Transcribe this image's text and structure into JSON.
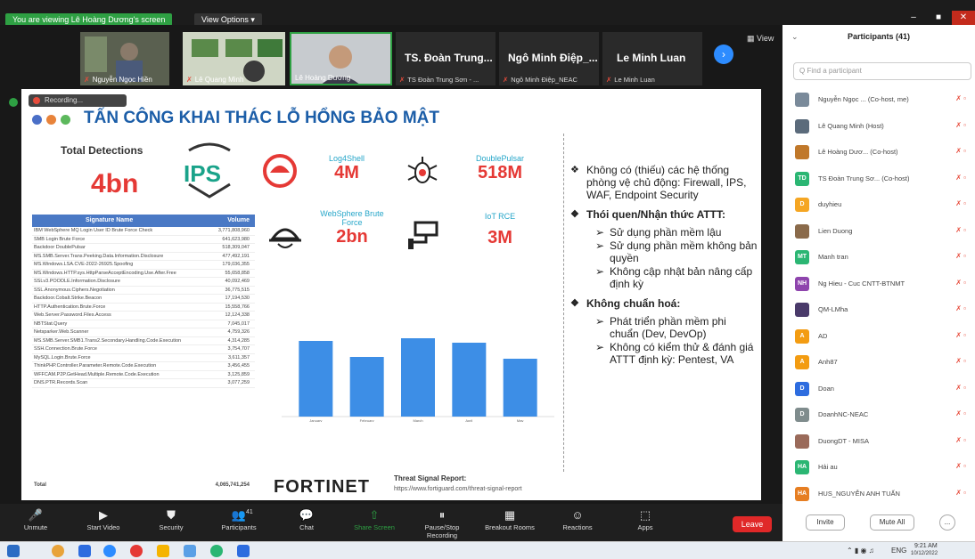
{
  "top": {
    "share_banner": "You are viewing Lê Hoàng Dương's screen",
    "view_options": "View Options ▾",
    "minimize": "–",
    "restore": "■",
    "close": "✕"
  },
  "gallery": {
    "thumbs": [
      {
        "name": "Nguyễn Ngọc Hiền"
      },
      {
        "name": "Lê Quang Minh"
      },
      {
        "name": "Lê Hoàng Dương"
      }
    ],
    "tiles": [
      {
        "title": "TS. Đoàn Trung...",
        "sub": "TS Đoàn Trung Sơn - ..."
      },
      {
        "title": "Ngô Minh Điệp_...",
        "sub": "Ngô Minh Điệp_NEAC"
      },
      {
        "title": "Le Minh Luan",
        "sub": "Le Minh Luan"
      }
    ],
    "next_icon": "chevron-right-icon",
    "view_label": "View"
  },
  "slide": {
    "recording": "Recording...",
    "title": "TẤN CÔNG KHAI THÁC LỖ HỔNG BẢO MẬT",
    "total_label": "Total Detections",
    "total_value": "4bn",
    "ips_label": "IPS",
    "threats": [
      {
        "name": "Log4Shell",
        "value": "4M",
        "icon": "helmet-icon"
      },
      {
        "name": "DoublePulsar",
        "value": "518M",
        "icon": "bug-icon"
      },
      {
        "name": "WebSphere Brute Force",
        "value": "2bn",
        "icon": "hacker-icon"
      },
      {
        "name": "IoT RCE",
        "value": "3M",
        "icon": "camera-icon"
      }
    ],
    "table": {
      "headers": [
        "Signature Name",
        "Volume"
      ],
      "rows": [
        [
          "IBM WebSphere MQ Login User ID Brute Force Check",
          "3,771,808,960"
        ],
        [
          "SMB Login Brute Force",
          "641,623,980"
        ],
        [
          "Backdoor DoublePulsar",
          "518,309,047"
        ],
        [
          "MS.SMB.Server.Trans.Peeking.Data.Information.Disclosure",
          "477,492,191"
        ],
        [
          "MS.Windows.LSA.CVE-2022-26925.Spoofing",
          "179,036,355"
        ],
        [
          "MS.Windows.HTTP.sys.HttpParseAcceptEncoding.Use.After.Free",
          "55,658,858"
        ],
        [
          "SSLv3.POODLE.Information.Disclosure",
          "40,092,469"
        ],
        [
          "SSL.Anonymous.Ciphers.Negotiation",
          "36,775,515"
        ],
        [
          "Backdoor.Cobalt.Strike.Beacon",
          "17,194,530"
        ],
        [
          "HTTP.Authentication.Brute.Force",
          "15,558,766"
        ],
        [
          "Web.Server.Password.Files.Access",
          "12,124,338"
        ],
        [
          "NBTStat.Query",
          "7,045,017"
        ],
        [
          "Netsparker.Web.Scanner",
          "4,759,326"
        ],
        [
          "MS.SMB.Server.SMB1.Trans2.Secondary.Handling.Code.Execution",
          "4,314,285"
        ],
        [
          "SSH.Connection.Brute.Force",
          "3,754,707"
        ],
        [
          "MySQL.Login.Brute.Force",
          "3,611,357"
        ],
        [
          "ThinkPHP.Controller.Parameter.Remote.Code.Execution",
          "3,456,455"
        ],
        [
          "WFFCAM.P2P.GetHead.Multiple.Remote.Code.Execution",
          "3,125,859"
        ],
        [
          "DNS.PTR.Records.Scan",
          "3,077,259"
        ]
      ],
      "total_label": "Total",
      "total_value": "4,065,741,254"
    },
    "fortinet": "FORTINET",
    "report_title": "Threat Signal Report:",
    "report_url": "https://www.fortiguard.com/threat-signal-report",
    "bullets": [
      {
        "main": "Không có (thiếu) các hệ thống phòng vệ chủ động: Firewall, IPS, WAF, Endpoint Security",
        "subs": []
      },
      {
        "main": "Thói quen/Nhận thức ATTT:",
        "subs": [
          "Sử dụng phần mềm lậu",
          "Sử dụng phần mềm không bản quyền",
          "Không cập nhật bản nâng cấp định kỳ"
        ]
      },
      {
        "main": "Không chuẩn hoá:",
        "subs": [
          "Phát triển phần mềm phi chuẩn (Dev, DevOp)",
          "Không có kiểm thử & đánh giá ATTT định kỳ: Pentest, VA"
        ]
      }
    ]
  },
  "chart_data": {
    "type": "bar",
    "categories": [
      "January",
      "February",
      "March",
      "April",
      "May"
    ],
    "values": [
      0.85,
      0.67,
      0.88,
      0.83,
      0.65
    ],
    "title": "",
    "xlabel": "",
    "ylabel": "",
    "color": "#3d8ee6"
  },
  "toolbar": {
    "items": [
      {
        "label": "Unmute",
        "icon": "mic-off-icon"
      },
      {
        "label": "Start Video",
        "icon": "video-off-icon"
      },
      {
        "label": "Security",
        "icon": "shield-icon"
      },
      {
        "label": "Participants",
        "icon": "participants-icon",
        "count": "41"
      },
      {
        "label": "Chat",
        "icon": "chat-icon"
      },
      {
        "label": "Share Screen",
        "icon": "share-screen-icon"
      },
      {
        "label": "Pause/Stop Recording",
        "icon": "record-icon"
      },
      {
        "label": "Breakout Rooms",
        "icon": "breakout-icon"
      },
      {
        "label": "Reactions",
        "icon": "reaction-icon"
      },
      {
        "label": "Apps",
        "icon": "apps-icon"
      }
    ],
    "leave": "Leave"
  },
  "panel": {
    "title": "Participants (41)",
    "search_placeholder": "Q Find a participant",
    "participants": [
      {
        "name": "Nguyễn Ngọc ... (Co-host, me)",
        "initials": "",
        "color": "#7a8a9a"
      },
      {
        "name": "Lê Quang Minh (Host)",
        "initials": "",
        "color": "#5b6b7b"
      },
      {
        "name": "Lê Hoàng Dươ... (Co-host)",
        "initials": "",
        "color": "#c0782a"
      },
      {
        "name": "TS Đoàn Trung Sơ... (Co-host)",
        "initials": "TD",
        "color": "#2bb673"
      },
      {
        "name": "duyhieu",
        "initials": "D",
        "color": "#f5a623"
      },
      {
        "name": "Lien Duong",
        "initials": "",
        "color": "#8a6a4a"
      },
      {
        "name": "Manh tran",
        "initials": "MT",
        "color": "#2bb673"
      },
      {
        "name": "Ng Hieu - Cuc CNTT-BTNMT",
        "initials": "NH",
        "color": "#8e44ad"
      },
      {
        "name": "QM-LMha",
        "initials": "",
        "color": "#4a3a6a"
      },
      {
        "name": "AD",
        "initials": "A",
        "color": "#f39c12"
      },
      {
        "name": "Anh87",
        "initials": "A",
        "color": "#f39c12"
      },
      {
        "name": "Doan",
        "initials": "D",
        "color": "#2d6cdf"
      },
      {
        "name": "DoanhNC-NEAC",
        "initials": "D",
        "color": "#7f8c8d"
      },
      {
        "name": "DuongDT - MISA",
        "initials": "",
        "color": "#9a6a5a"
      },
      {
        "name": "Hải au",
        "initials": "HA",
        "color": "#2bb673"
      },
      {
        "name": "HUS_NGUYỄN ANH TUẤN",
        "initials": "HA",
        "color": "#e67e22"
      }
    ],
    "invite": "Invite",
    "mute_all": "Mute All",
    "more": "..."
  },
  "taskbar": {
    "lang": "ENG",
    "time": "9:21 AM",
    "date": "10/12/2022"
  }
}
